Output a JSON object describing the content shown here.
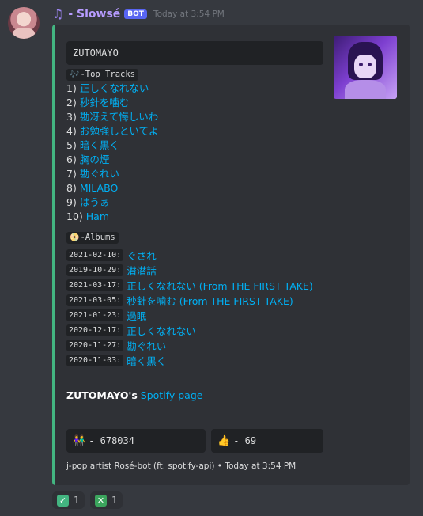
{
  "message": {
    "username": "- Slowsé",
    "bot_badge": "BOT",
    "timestamp": "Today at 3:54 PM",
    "icon": "music-note-icon"
  },
  "embed": {
    "accent_color": "#43b581",
    "title": "ZUTOMAYO",
    "top_tracks_label": "-Top Tracks",
    "tracks": [
      {
        "num": "1)",
        "title": "正しくなれない"
      },
      {
        "num": "2)",
        "title": "秒針を噛む"
      },
      {
        "num": "3)",
        "title": "勘冴えて悔しいわ"
      },
      {
        "num": "4)",
        "title": "お勉強しといてよ"
      },
      {
        "num": "5)",
        "title": "暗く黒く"
      },
      {
        "num": "6)",
        "title": "胸の煙"
      },
      {
        "num": "7)",
        "title": "勘ぐれい"
      },
      {
        "num": "8)",
        "title": "MILABO"
      },
      {
        "num": "9)",
        "title": "はうぁ"
      },
      {
        "num": "10)",
        "title": "Ham"
      }
    ],
    "albums_label": "-Albums",
    "albums": [
      {
        "date": "2021-02-10:",
        "title": "ぐされ"
      },
      {
        "date": "2019-10-29:",
        "title": "潜潜話"
      },
      {
        "date": "2021-03-17:",
        "title": "正しくなれない (From THE FIRST TAKE)"
      },
      {
        "date": "2021-03-05:",
        "title": "秒針を噛む (From THE FIRST TAKE)"
      },
      {
        "date": "2021-01-23:",
        "title": "過眠"
      },
      {
        "date": "2020-12-17:",
        "title": "正しくなれない"
      },
      {
        "date": "2020-11-27:",
        "title": "勘ぐれい"
      },
      {
        "date": "2020-11-03:",
        "title": "暗く黒く"
      }
    ],
    "spotify_artist": "ZUTOMAYO's",
    "spotify_link": "Spotify page",
    "followers": "- 678034",
    "popularity": "- 69",
    "footer": "j-pop  artist  Rosé-bot (ft. spotify-api) • Today at 3:54 PM"
  },
  "reactions": [
    {
      "icon": "check-mark-icon",
      "count": "1"
    },
    {
      "icon": "cross-mark-icon",
      "count": "1"
    }
  ]
}
